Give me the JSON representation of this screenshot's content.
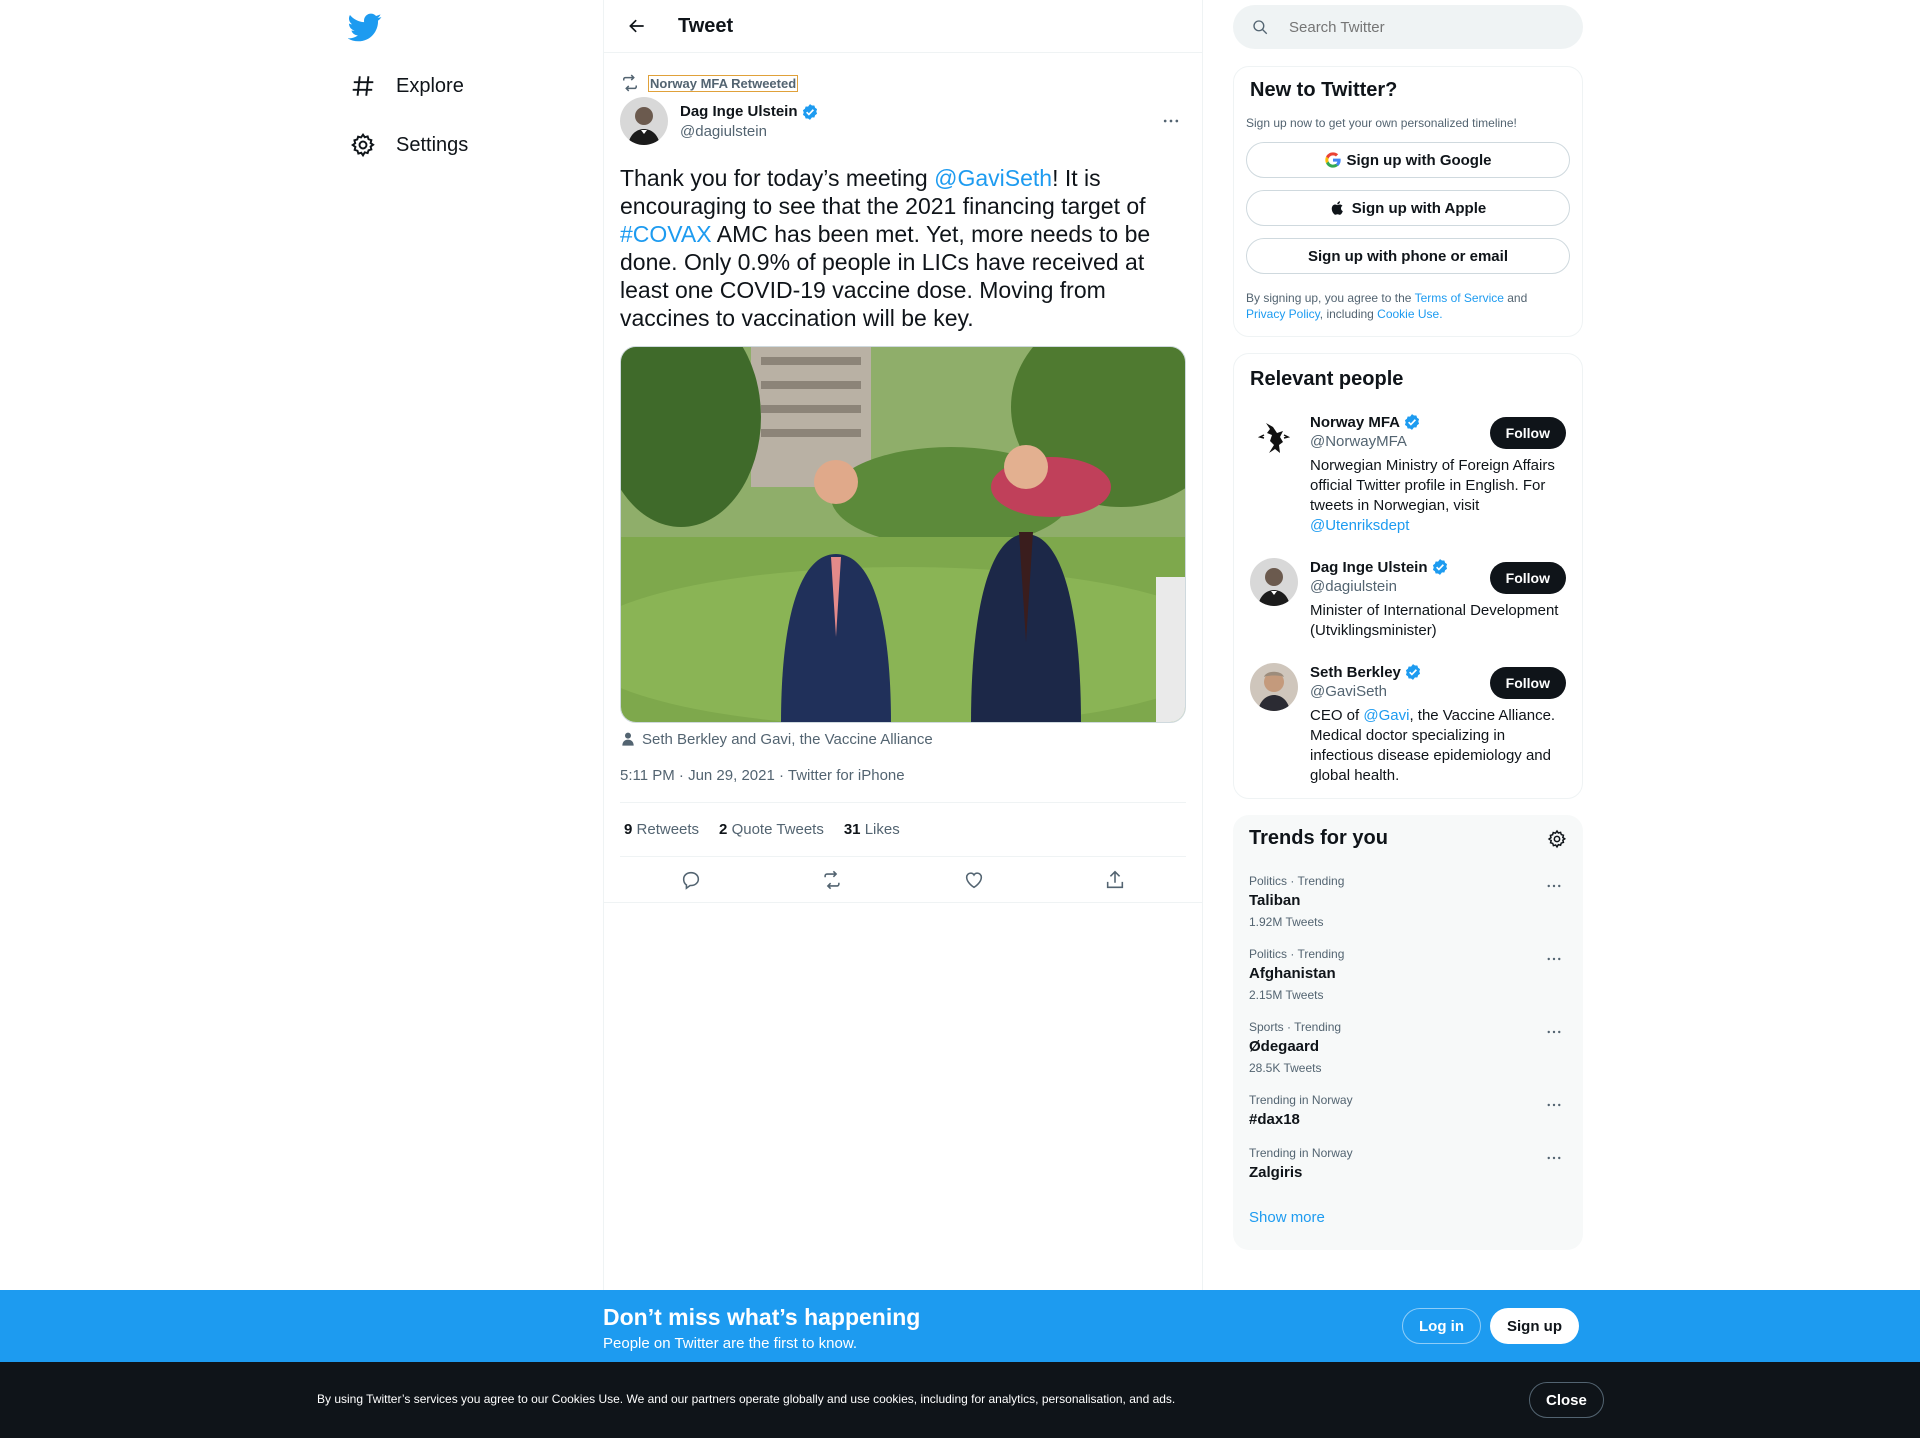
{
  "nav": {
    "items": [
      {
        "label": "Explore",
        "icon": "hashtag-icon"
      },
      {
        "label": "Settings",
        "icon": "gear-icon"
      }
    ]
  },
  "header": {
    "title": "Tweet"
  },
  "tweet": {
    "retweeted_by": "Norway MFA Retweeted",
    "author_name": "Dag Inge Ulstein",
    "author_handle": "@dagiulstein",
    "text_parts": {
      "p1": "Thank you for today’s meeting ",
      "mention": "@GaviSeth",
      "p2": "! It is encouraging to see that the 2021 financing target of ",
      "hashtag": "#COVAX",
      "p3": " AMC has been met. Yet, more needs to be done. Only 0.9% of people in LICs have received at least one COVID-19 vaccine dose. Moving from vaccines to vaccination will be key."
    },
    "tagged": "Seth Berkley and Gavi, the Vaccine Alliance",
    "meta": "5:11 PM · Jun 29, 2021 · Twitter for iPhone",
    "stats": {
      "retweets_count": "9",
      "retweets_label": "Retweets",
      "quotes_count": "2",
      "quotes_label": "Quote Tweets",
      "likes_count": "31",
      "likes_label": "Likes"
    }
  },
  "search": {
    "placeholder": "Search Twitter"
  },
  "signup": {
    "title": "New to Twitter?",
    "subtitle": "Sign up now to get your own personalized timeline!",
    "google": "Sign up with Google",
    "apple": "Sign up with Apple",
    "phone": "Sign up with phone or email",
    "terms_1": "By signing up, you agree to the ",
    "terms_tos": "Terms of Service",
    "terms_2": " and ",
    "terms_privacy": "Privacy Policy",
    "terms_3": ", including ",
    "terms_cookie": "Cookie Use."
  },
  "relevant": {
    "title": "Relevant people",
    "people": [
      {
        "name": "Norway MFA",
        "handle": "@NorwayMFA",
        "bio": "Norwegian Ministry of Foreign Affairs official Twitter profile in English. For tweets in Norwegian, visit ",
        "bio_link": "@Utenriksdept",
        "bio_after": "",
        "follow": "Follow"
      },
      {
        "name": "Dag Inge Ulstein",
        "handle": "@dagiulstein",
        "bio": "Minister of International Development (Utviklingsminister)",
        "bio_link": "",
        "bio_after": "",
        "follow": "Follow"
      },
      {
        "name": "Seth Berkley",
        "handle": "@GaviSeth",
        "bio": "CEO of ",
        "bio_link": "@Gavi",
        "bio_after": ", the Vaccine Alliance. Medical doctor specializing in infectious disease epidemiology and global health.",
        "follow": "Follow"
      }
    ]
  },
  "trends": {
    "title": "Trends for you",
    "items": [
      {
        "category": "Politics · Trending",
        "name": "Taliban",
        "count": "1.92M Tweets"
      },
      {
        "category": "Politics · Trending",
        "name": "Afghanistan",
        "count": "2.15M Tweets"
      },
      {
        "category": "Sports · Trending",
        "name": "Ødegaard",
        "count": "28.5K Tweets"
      },
      {
        "category": "Trending in Norway",
        "name": "#dax18",
        "count": ""
      },
      {
        "category": "Trending in Norway",
        "name": "Zalgiris",
        "count": ""
      }
    ],
    "show_more": "Show more"
  },
  "banner": {
    "title": "Don’t miss what’s happening",
    "subtitle": "People on Twitter are the first to know.",
    "login": "Log in",
    "signup": "Sign up"
  },
  "cookie": {
    "text": "By using Twitter’s services you agree to our Cookies Use. We and our partners operate globally and use cookies, including for analytics, personalisation, and ads.",
    "close": "Close"
  },
  "colors": {
    "accent": "#1d9bf0",
    "text": "#0f1419",
    "muted": "#536471"
  }
}
